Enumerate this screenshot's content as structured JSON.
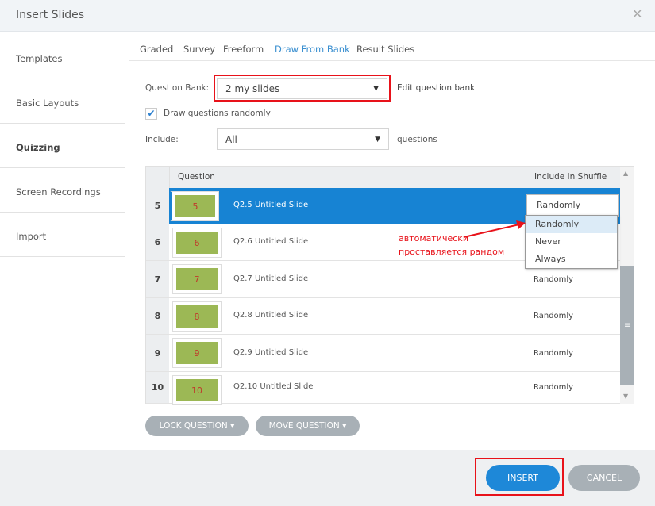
{
  "dialog": {
    "title": "Insert Slides",
    "close_icon": "close-icon"
  },
  "sidebar": {
    "items": [
      {
        "label": "Templates"
      },
      {
        "label": "Basic Layouts"
      },
      {
        "label": "Quizzing",
        "active": true
      },
      {
        "label": "Screen Recordings"
      },
      {
        "label": "Import"
      }
    ]
  },
  "tabs": [
    {
      "label": "Graded"
    },
    {
      "label": "Survey"
    },
    {
      "label": "Freeform"
    },
    {
      "label": "Draw From Bank",
      "active": true
    },
    {
      "label": "Result Slides"
    }
  ],
  "form": {
    "bank_label": "Question Bank:",
    "bank_value": "2 my slides",
    "edit_link": "Edit question bank",
    "draw_random_label": "Draw questions randomly",
    "draw_random_checked": true,
    "include_label": "Include:",
    "include_value": "All",
    "questions_suffix": "questions"
  },
  "table": {
    "headers": {
      "question": "Question",
      "shuffle": "Include In Shuffle"
    },
    "rows": [
      {
        "num": "5",
        "thumb": "5",
        "name": "Q2.5 Untitled Slide",
        "shuffle": "Randomly",
        "selected": true
      },
      {
        "num": "6",
        "thumb": "6",
        "name": "Q2.6 Untitled Slide",
        "shuffle": ""
      },
      {
        "num": "7",
        "thumb": "7",
        "name": "Q2.7 Untitled Slide",
        "shuffle": "Randomly"
      },
      {
        "num": "8",
        "thumb": "8",
        "name": "Q2.8 Untitled Slide",
        "shuffle": "Randomly"
      },
      {
        "num": "9",
        "thumb": "9",
        "name": "Q2.9 Untitled Slide",
        "shuffle": "Randomly"
      },
      {
        "num": "10",
        "thumb": "10",
        "name": "Q2.10 Untitled Slide",
        "shuffle": "Randomly"
      }
    ]
  },
  "shuffle_dropdown": {
    "options": [
      "Randomly",
      "Never",
      "Always"
    ],
    "highlighted": "Randomly"
  },
  "annotation": {
    "line1": "автоматически",
    "line2": "проставляется рандом",
    "color": "#e8121a"
  },
  "actions": {
    "lock": "LOCK QUESTION ▾",
    "move": "MOVE QUESTION ▾"
  },
  "footer": {
    "insert": "INSERT",
    "cancel": "CANCEL"
  },
  "colors": {
    "accent": "#1783d3",
    "highlight_red": "#e8121a"
  }
}
